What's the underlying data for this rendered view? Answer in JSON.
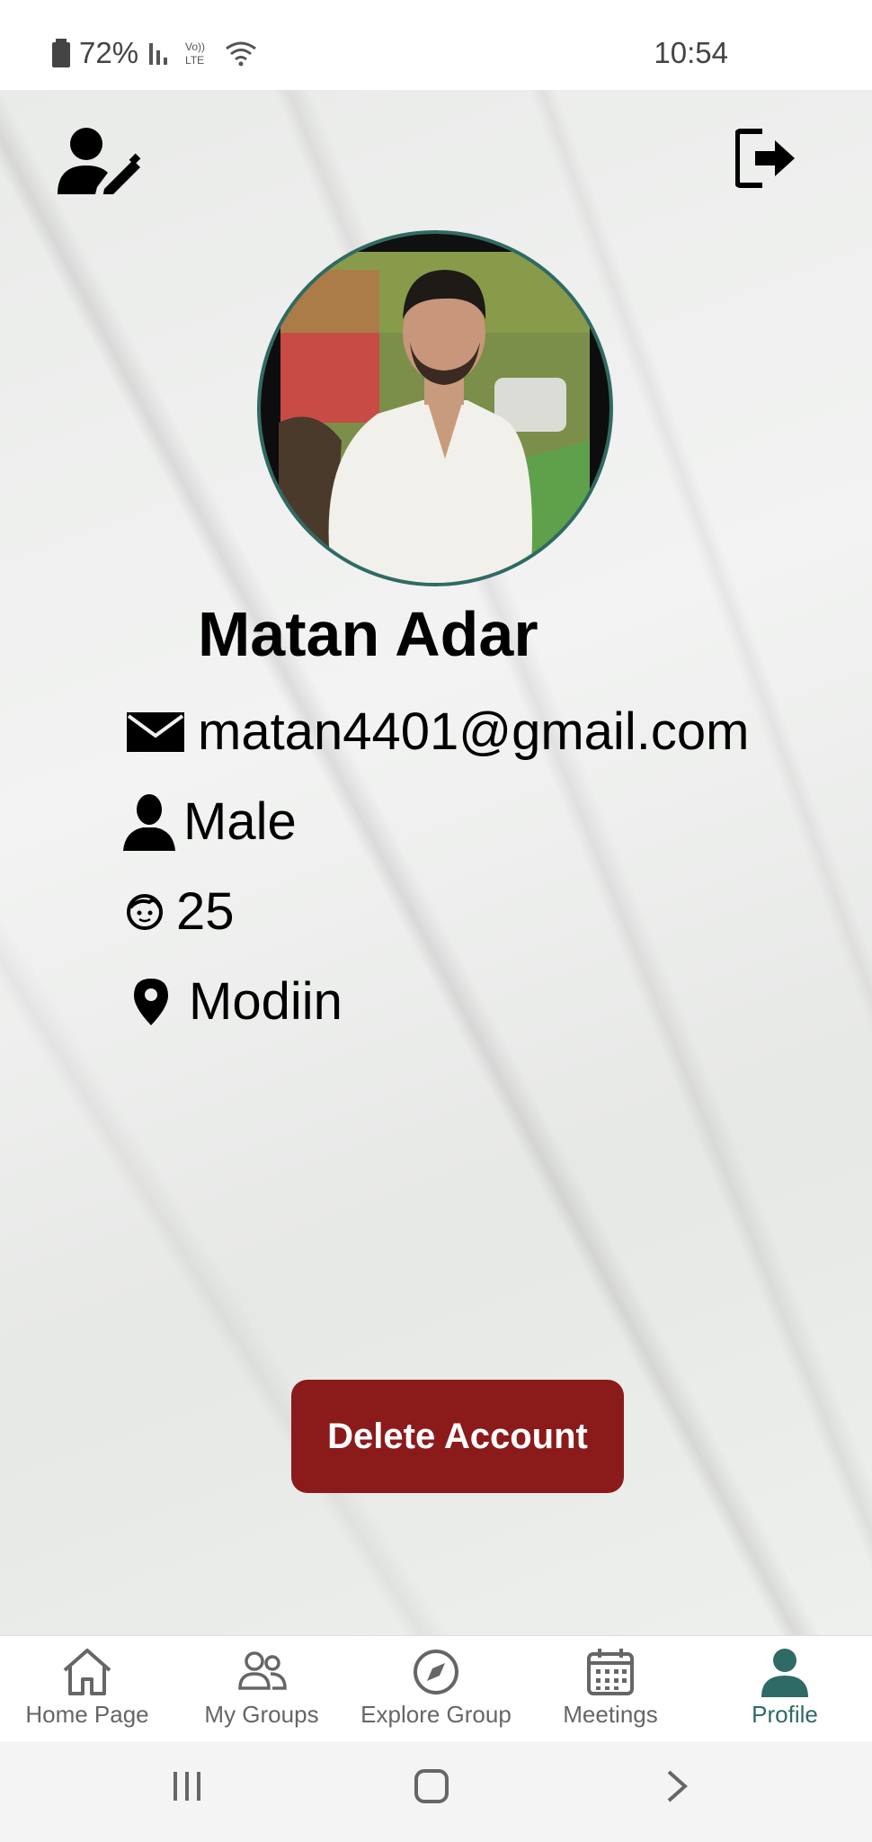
{
  "status_bar": {
    "battery": "72%",
    "clock": "10:54"
  },
  "profile": {
    "name": "Matan Adar",
    "email": "matan4401@gmail.com",
    "gender": "Male",
    "age": "25",
    "location": "Modiin"
  },
  "actions": {
    "delete_label": "Delete Account"
  },
  "nav": {
    "items": [
      {
        "label": "Home Page",
        "icon": "home-icon"
      },
      {
        "label": "My Groups",
        "icon": "groups-icon"
      },
      {
        "label": "Explore Group",
        "icon": "compass-icon"
      },
      {
        "label": "Meetings",
        "icon": "calendar-icon"
      },
      {
        "label": "Profile",
        "icon": "person-icon"
      }
    ],
    "active": "Profile"
  },
  "colors": {
    "accent": "#2f6a64",
    "danger": "#8b1a1a"
  }
}
